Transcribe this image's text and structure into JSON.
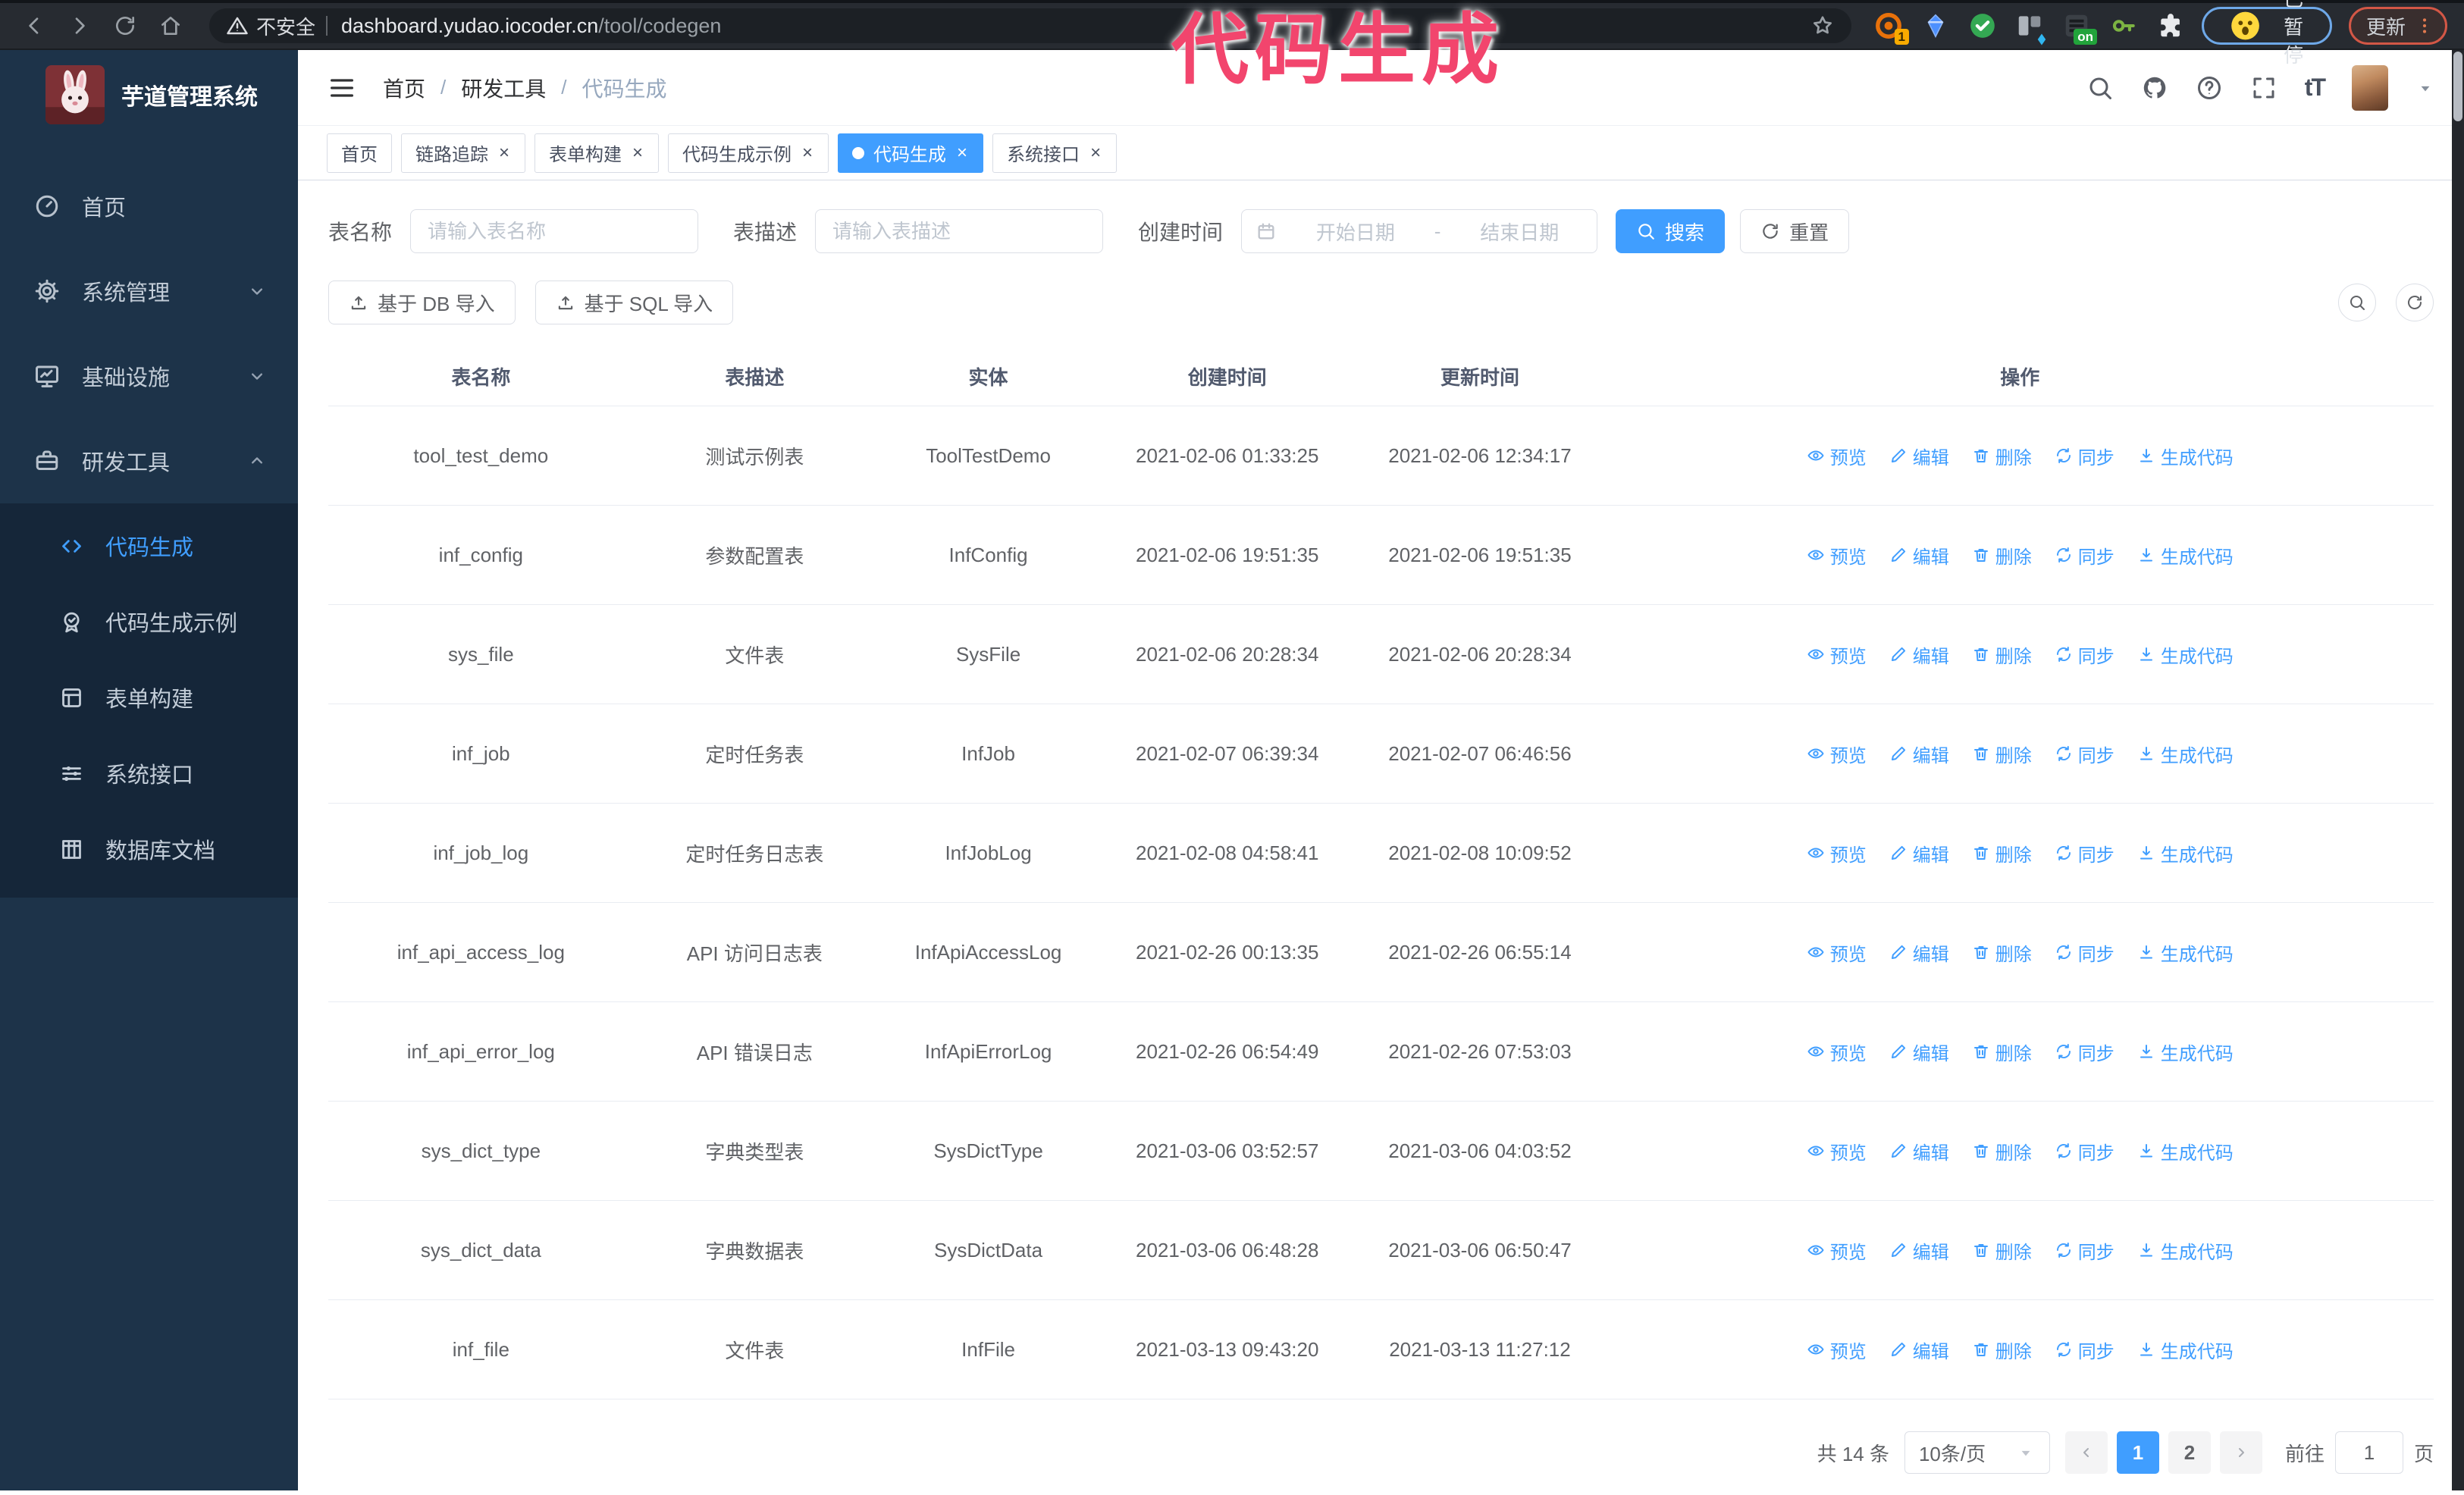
{
  "colors": {
    "accent": "#409EFF",
    "sidebar_bg": "#1d3349",
    "submenu_bg": "#152639",
    "annotation": "#f2456d",
    "tab_active_bg": "#409EFF"
  },
  "browser": {
    "security_label": "不安全",
    "url_host": "dashboard.yudao.iocoder.cn",
    "url_path": "/tool/codegen",
    "extension_badge_count": "1",
    "extension_badge_on": "on",
    "paused_badge": "已暂停",
    "update_button": "更新"
  },
  "annotation": {
    "text": "代码生成"
  },
  "sidebar": {
    "title": "芋道管理系统",
    "items": [
      {
        "key": "home",
        "label": "首页",
        "icon": "dashboard"
      },
      {
        "key": "system",
        "label": "系统管理",
        "icon": "gear",
        "chevron": "down"
      },
      {
        "key": "infra",
        "label": "基础设施",
        "icon": "monitor",
        "chevron": "down"
      },
      {
        "key": "devtools",
        "label": "研发工具",
        "icon": "toolbox",
        "chevron": "up"
      }
    ],
    "subitems": [
      {
        "key": "codegen",
        "label": "代码生成",
        "icon": "code",
        "active": true
      },
      {
        "key": "codegen-example",
        "label": "代码生成示例",
        "icon": "badge",
        "active": false
      },
      {
        "key": "form-builder",
        "label": "表单构建",
        "icon": "form",
        "active": false
      },
      {
        "key": "system-api",
        "label": "系统接口",
        "icon": "sliders",
        "active": false
      },
      {
        "key": "db-doc",
        "label": "数据库文档",
        "icon": "columns",
        "active": false
      }
    ]
  },
  "header": {
    "breadcrumb": [
      "首页",
      "研发工具",
      "代码生成"
    ]
  },
  "tabs": [
    {
      "key": "home",
      "label": "首页",
      "closable": false,
      "active": false
    },
    {
      "key": "trace",
      "label": "链路追踪",
      "closable": true,
      "active": false
    },
    {
      "key": "form-builder",
      "label": "表单构建",
      "closable": true,
      "active": false
    },
    {
      "key": "codegen-example",
      "label": "代码生成示例",
      "closable": true,
      "active": false
    },
    {
      "key": "codegen",
      "label": "代码生成",
      "closable": true,
      "active": true
    },
    {
      "key": "system-api",
      "label": "系统接口",
      "closable": true,
      "active": false
    }
  ],
  "search": {
    "name_label": "表名称",
    "name_placeholder": "请输入表名称",
    "desc_label": "表描述",
    "desc_placeholder": "请输入表描述",
    "time_label": "创建时间",
    "start_placeholder": "开始日期",
    "range_separator": "-",
    "end_placeholder": "结束日期",
    "search_button": "搜索",
    "reset_button": "重置"
  },
  "toolbar": {
    "import_db_button": "基于 DB 导入",
    "import_sql_button": "基于 SQL 导入"
  },
  "table": {
    "columns": [
      "表名称",
      "表描述",
      "实体",
      "创建时间",
      "更新时间",
      "操作"
    ],
    "actions": [
      {
        "key": "preview",
        "label": "预览",
        "icon": "eye"
      },
      {
        "key": "edit",
        "label": "编辑",
        "icon": "edit"
      },
      {
        "key": "delete",
        "label": "删除",
        "icon": "trash"
      },
      {
        "key": "sync",
        "label": "同步",
        "icon": "sync"
      },
      {
        "key": "generate-code",
        "label": "生成代码",
        "icon": "gencode"
      }
    ],
    "rows": [
      {
        "name": "tool_test_demo",
        "desc": "测试示例表",
        "entity": "ToolTestDemo",
        "created": "2021-02-06 01:33:25",
        "updated": "2021-02-06 12:34:17"
      },
      {
        "name": "inf_config",
        "desc": "参数配置表",
        "entity": "InfConfig",
        "created": "2021-02-06 19:51:35",
        "updated": "2021-02-06 19:51:35"
      },
      {
        "name": "sys_file",
        "desc": "文件表",
        "entity": "SysFile",
        "created": "2021-02-06 20:28:34",
        "updated": "2021-02-06 20:28:34"
      },
      {
        "name": "inf_job",
        "desc": "定时任务表",
        "entity": "InfJob",
        "created": "2021-02-07 06:39:34",
        "updated": "2021-02-07 06:46:56"
      },
      {
        "name": "inf_job_log",
        "desc": "定时任务日志表",
        "entity": "InfJobLog",
        "created": "2021-02-08 04:58:41",
        "updated": "2021-02-08 10:09:52"
      },
      {
        "name": "inf_api_access_log",
        "desc": "API 访问日志表",
        "entity": "InfApiAccessLog",
        "created": "2021-02-26 00:13:35",
        "updated": "2021-02-26 06:55:14"
      },
      {
        "name": "inf_api_error_log",
        "desc": "API 错误日志",
        "entity": "InfApiErrorLog",
        "created": "2021-02-26 06:54:49",
        "updated": "2021-02-26 07:53:03"
      },
      {
        "name": "sys_dict_type",
        "desc": "字典类型表",
        "entity": "SysDictType",
        "created": "2021-03-06 03:52:57",
        "updated": "2021-03-06 04:03:52"
      },
      {
        "name": "sys_dict_data",
        "desc": "字典数据表",
        "entity": "SysDictData",
        "created": "2021-03-06 06:48:28",
        "updated": "2021-03-06 06:50:47"
      },
      {
        "name": "inf_file",
        "desc": "文件表",
        "entity": "InfFile",
        "created": "2021-03-13 09:43:20",
        "updated": "2021-03-13 11:27:12"
      }
    ]
  },
  "pagination": {
    "total": "共 14 条",
    "page_size": "10条/页",
    "pages": [
      "1",
      "2"
    ],
    "active_page": "1",
    "goto_label": "前往",
    "goto_value": "1",
    "page_suffix": "页"
  }
}
